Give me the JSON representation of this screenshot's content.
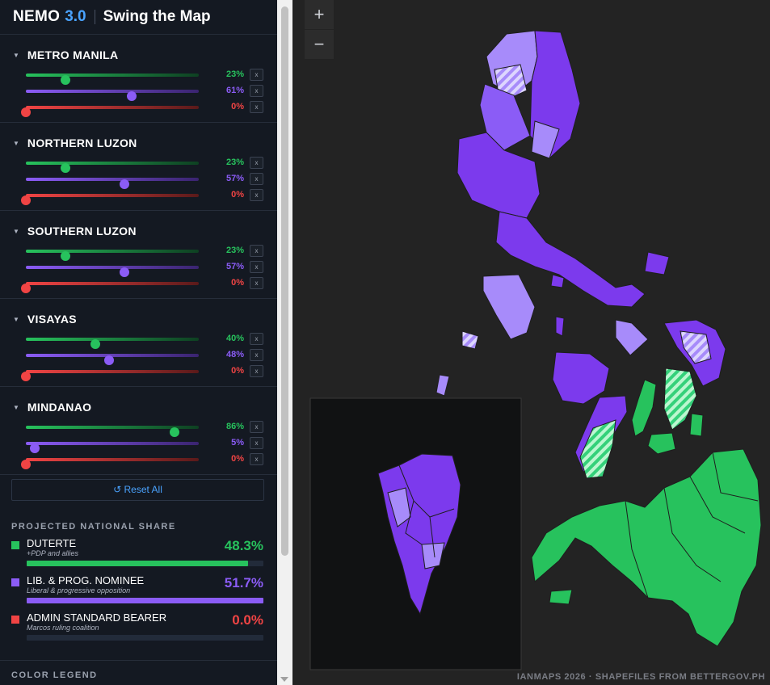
{
  "header": {
    "brand": "NEMO",
    "version": "3.0",
    "title": "Swing the Map"
  },
  "regions": [
    {
      "name": "METRO MANILA",
      "sliders": [
        {
          "value": 23,
          "label": "23%",
          "color": "green"
        },
        {
          "value": 61,
          "label": "61%",
          "color": "purple"
        },
        {
          "value": 0,
          "label": "0%",
          "color": "red"
        }
      ]
    },
    {
      "name": "NORTHERN LUZON",
      "sliders": [
        {
          "value": 23,
          "label": "23%",
          "color": "green"
        },
        {
          "value": 57,
          "label": "57%",
          "color": "purple"
        },
        {
          "value": 0,
          "label": "0%",
          "color": "red"
        }
      ]
    },
    {
      "name": "SOUTHERN LUZON",
      "sliders": [
        {
          "value": 23,
          "label": "23%",
          "color": "green"
        },
        {
          "value": 57,
          "label": "57%",
          "color": "purple"
        },
        {
          "value": 0,
          "label": "0%",
          "color": "red"
        }
      ]
    },
    {
      "name": "VISAYAS",
      "sliders": [
        {
          "value": 40,
          "label": "40%",
          "color": "green"
        },
        {
          "value": 48,
          "label": "48%",
          "color": "purple"
        },
        {
          "value": 0,
          "label": "0%",
          "color": "red"
        }
      ]
    },
    {
      "name": "MINDANAO",
      "sliders": [
        {
          "value": 86,
          "label": "86%",
          "color": "green"
        },
        {
          "value": 5,
          "label": "5%",
          "color": "purple"
        },
        {
          "value": 0,
          "label": "0%",
          "color": "red"
        }
      ]
    }
  ],
  "slider_remove_label": "x",
  "reset_label": "↺ Reset All",
  "projected": {
    "label": "PROJECTED NATIONAL SHARE",
    "candidates": [
      {
        "name": "DUTERTE",
        "sub": "+PDP and allies",
        "value": "48.3%",
        "share": 48.3,
        "color": "#27c25d"
      },
      {
        "name": "LIB. & PROG. NOMINEE",
        "sub": "Liberal & progressive opposition",
        "value": "51.7%",
        "share": 51.7,
        "color": "#8b5cf6"
      },
      {
        "name": "ADMIN STANDARD BEARER",
        "sub": "Marcos ruling coalition",
        "value": "0.0%",
        "share": 0.0,
        "color": "#f04444"
      }
    ]
  },
  "legend_label": "COLOR LEGEND",
  "map": {
    "zoom_in": "+",
    "zoom_out": "−",
    "attribution": "IANMAPS 2026 · SHAPEFILES FROM BETTERGOV.PH",
    "colors": {
      "duterte": "#27c25d",
      "opposition": "#7c3aed",
      "opposition_light": "#a78bfa",
      "admin": "#f04444"
    }
  }
}
